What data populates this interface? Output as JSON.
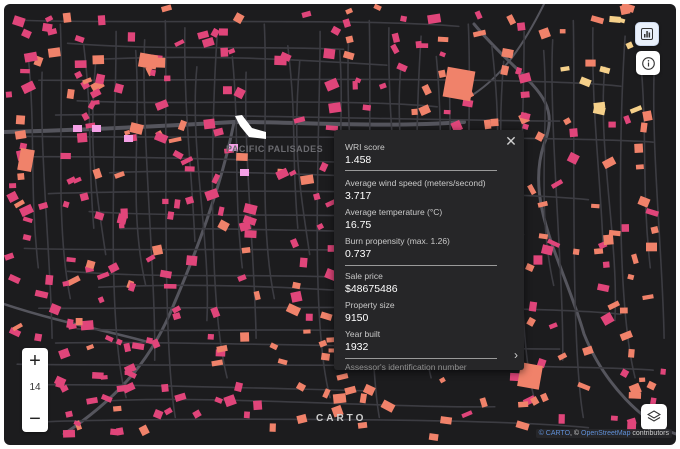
{
  "map": {
    "place_label": "PACIFIC PALISADES",
    "colors": {
      "background": "#1c1c1e",
      "road": "#3c3c42",
      "major_road": "#55555d",
      "selected_parcel": "#ffffff",
      "parcel_low": "#f5d08a",
      "parcel_mid": "#f0826a",
      "parcel_high": "#e0457a",
      "parcel_max": "#f5a0e6"
    }
  },
  "controls": {
    "zoom_in_label": "+",
    "zoom_out_label": "−",
    "zoom_level": "14",
    "chart_icon": "bar-chart-icon",
    "info_icon": "info-icon",
    "layers_icon": "layers-icon"
  },
  "popup": {
    "close_label": "✕",
    "expand_label": "›",
    "fields": [
      {
        "label": "WRI score",
        "value": "1.458"
      },
      {
        "label": "Average wind speed (meters/second)",
        "value": "3.717"
      },
      {
        "label": "Average temperature (°C)",
        "value": "16.75"
      },
      {
        "label": "Burn propensity (max. 1.26)",
        "value": "0.737"
      },
      {
        "label": "Sale price",
        "value": "$48675486"
      },
      {
        "label": "Property size",
        "value": "9150"
      },
      {
        "label": "Year built",
        "value": "1932"
      }
    ],
    "truncated_label": "Assessor's identification number"
  },
  "footer": {
    "logo": "CARTO",
    "attribution_carto": "© CARTO",
    "attribution_sep": ", ©",
    "attribution_osm": "OpenStreetMap",
    "attribution_tail": " contributors"
  }
}
